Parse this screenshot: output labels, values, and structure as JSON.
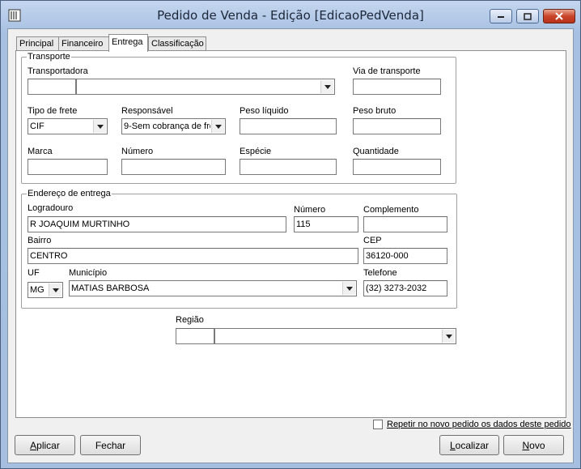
{
  "window": {
    "title": "Pedido de Venda - Edição [EdicaoPedVenda]"
  },
  "tabs": [
    {
      "label": "Principal"
    },
    {
      "label": "Financeiro"
    },
    {
      "label": "Entrega"
    },
    {
      "label": "Classificação"
    }
  ],
  "transporte": {
    "group_label": "Transporte",
    "transportadora": {
      "label": "Transportadora",
      "code": "",
      "name": ""
    },
    "via": {
      "label": "Via de transporte",
      "value": ""
    },
    "tipo_frete": {
      "label": "Tipo de frete",
      "value": "CIF"
    },
    "responsavel": {
      "label": "Responsável",
      "value": "9-Sem cobrança de fre"
    },
    "peso_liquido": {
      "label": "Peso líquido",
      "value": ""
    },
    "peso_bruto": {
      "label": "Peso bruto",
      "value": ""
    },
    "marca": {
      "label": "Marca",
      "value": ""
    },
    "numero": {
      "label": "Número",
      "value": ""
    },
    "especie": {
      "label": "Espécie",
      "value": ""
    },
    "quantidade": {
      "label": "Quantidade",
      "value": ""
    }
  },
  "endereco": {
    "group_label": "Endereço de entrega",
    "logradouro": {
      "label": "Logradouro",
      "value": "R JOAQUIM MURTINHO"
    },
    "numero": {
      "label": "Número",
      "value": "115"
    },
    "complemento": {
      "label": "Complemento",
      "value": ""
    },
    "bairro": {
      "label": "Bairro",
      "value": "CENTRO"
    },
    "cep": {
      "label": "CEP",
      "value": "36120-000"
    },
    "uf": {
      "label": "UF",
      "value": "MG"
    },
    "municipio": {
      "label": "Município",
      "value": "MATIAS BARBOSA"
    },
    "telefone": {
      "label": "Telefone",
      "value": "(32) 3273-2032"
    }
  },
  "regiao": {
    "label": "Região",
    "code": "",
    "name": ""
  },
  "footer": {
    "repeat_checkbox": {
      "label": "Repetir no novo pedido os dados deste pedido",
      "checked": false
    },
    "aplicar": {
      "accel": "A",
      "rest": "plicar"
    },
    "fechar": "Fechar",
    "localizar": {
      "accel": "L",
      "rest": "ocalizar"
    },
    "novo": {
      "accel": "N",
      "rest": "ovo"
    }
  }
}
